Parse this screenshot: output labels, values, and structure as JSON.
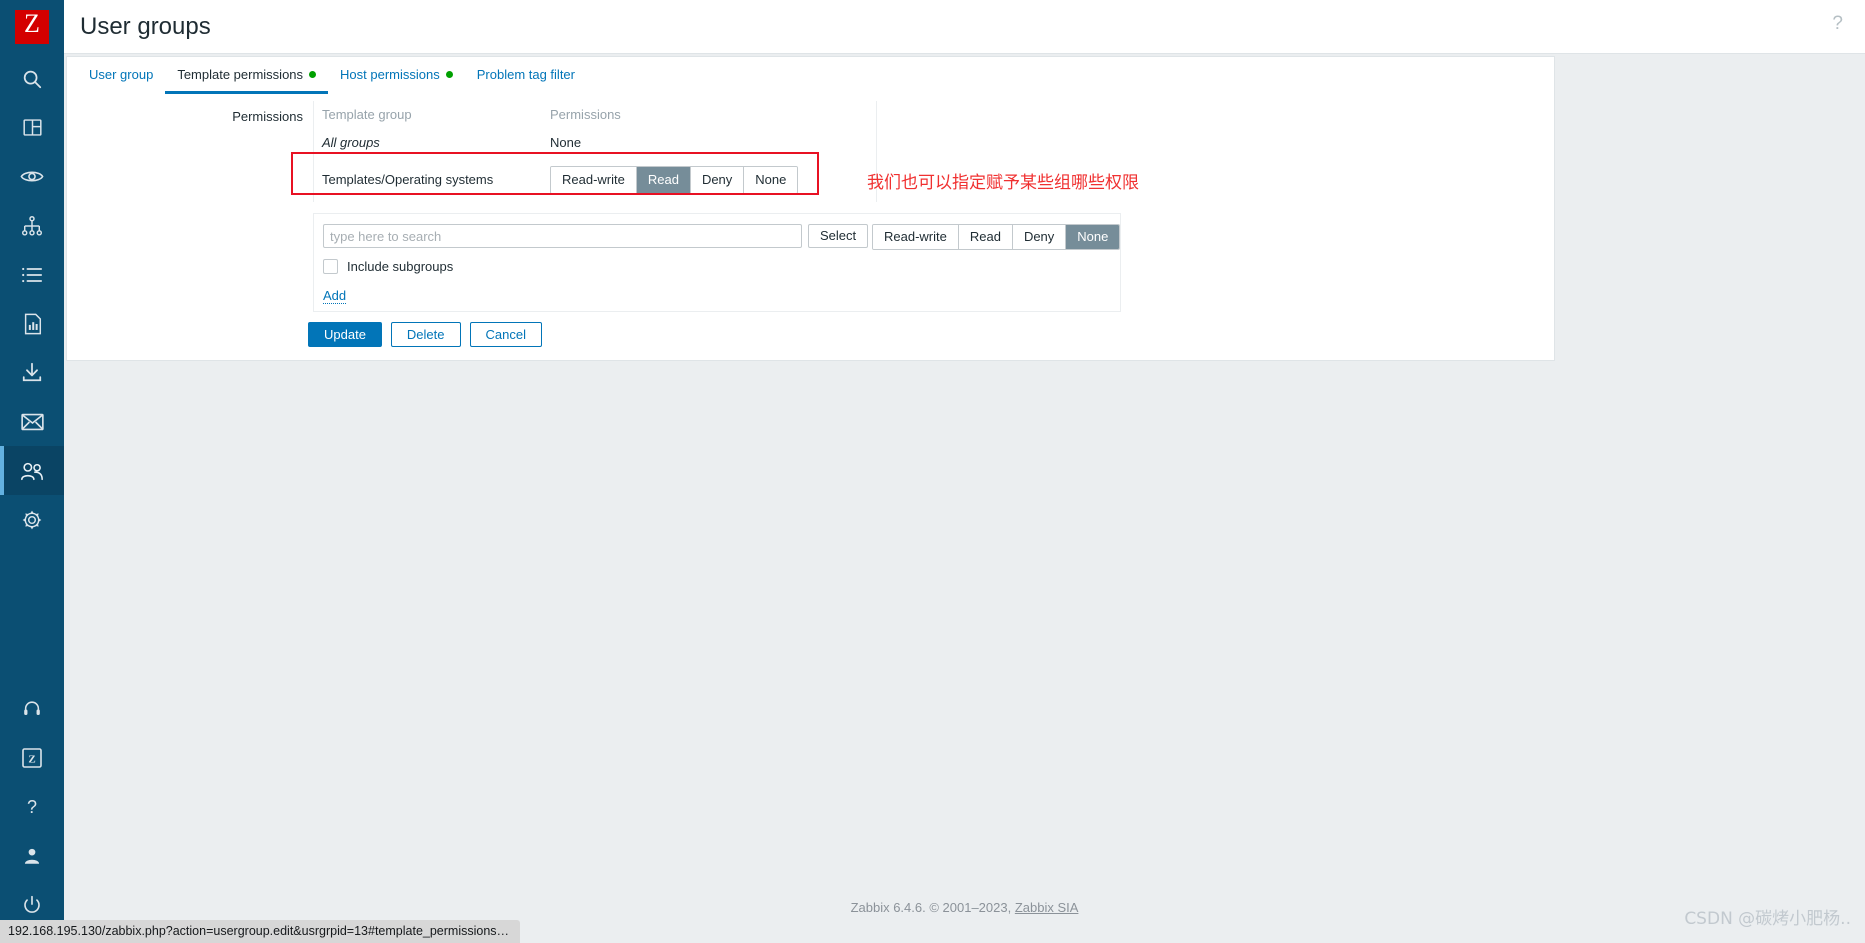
{
  "header": {
    "title": "User groups",
    "help_icon": "question-mark-icon",
    "help_label": "?"
  },
  "sidebar": {
    "logo_letter": "Z",
    "items": [
      {
        "name": "search-icon",
        "label": "Search"
      },
      {
        "name": "dashboards-icon",
        "label": "Dashboards"
      },
      {
        "name": "monitoring-icon",
        "label": "Monitoring"
      },
      {
        "name": "services-icon",
        "label": "Services"
      },
      {
        "name": "inventory-icon",
        "label": "Inventory"
      },
      {
        "name": "reports-icon",
        "label": "Reports"
      },
      {
        "name": "data-collection-icon",
        "label": "Data collection"
      },
      {
        "name": "alerts-icon",
        "label": "Alerts"
      },
      {
        "name": "users-icon",
        "label": "Users",
        "active": true
      },
      {
        "name": "administration-icon",
        "label": "Administration"
      }
    ],
    "bottom_items": [
      {
        "name": "support-icon",
        "label": "Support"
      },
      {
        "name": "integrations-icon",
        "label": "Integrations"
      },
      {
        "name": "help-icon",
        "label": "Help"
      },
      {
        "name": "user-settings-icon",
        "label": "User settings"
      },
      {
        "name": "sign-out-icon",
        "label": "Sign out"
      }
    ]
  },
  "tabs": [
    {
      "label": "User group",
      "selected": false,
      "dot": false
    },
    {
      "label": "Template permissions",
      "selected": true,
      "dot": true
    },
    {
      "label": "Host permissions",
      "selected": false,
      "dot": true
    },
    {
      "label": "Problem tag filter",
      "selected": false,
      "dot": false
    }
  ],
  "form": {
    "permissions_label": "Permissions",
    "table": {
      "headers": [
        "Template group",
        "Permissions"
      ],
      "rows": [
        {
          "group": "All groups",
          "style": "italic",
          "permission": "None",
          "has_seg": false
        },
        {
          "group": "Templates/Operating systems",
          "style": "plain",
          "has_seg": true,
          "seg_options": [
            "Read-write",
            "Read",
            "Deny",
            "None"
          ],
          "seg_selected": "Read"
        }
      ]
    },
    "new_entry": {
      "search_placeholder": "type here to search",
      "search_value": "",
      "select_label": "Select",
      "seg_options": [
        "Read-write",
        "Read",
        "Deny",
        "None"
      ],
      "seg_selected": "None",
      "include_subgroups_label": "Include subgroups",
      "include_subgroups_checked": false,
      "add_label": "Add"
    },
    "buttons": [
      {
        "label": "Update",
        "kind": "primary"
      },
      {
        "label": "Delete",
        "kind": "secondary"
      },
      {
        "label": "Cancel",
        "kind": "secondary"
      }
    ]
  },
  "annotation": {
    "text": "我们也可以指定赋予某些组哪些权限",
    "color": "#f03030",
    "box_color": "#e81123"
  },
  "footer": {
    "text": "Zabbix 6.4.6. © 2001–2023, ",
    "link": "Zabbix SIA"
  },
  "watermark": "CSDN @碳烤小肥杨..",
  "statusbar": {
    "url": "192.168.195.130/zabbix.php?action=usergroup.edit&usrgrpid=13#template_permissions_..."
  }
}
